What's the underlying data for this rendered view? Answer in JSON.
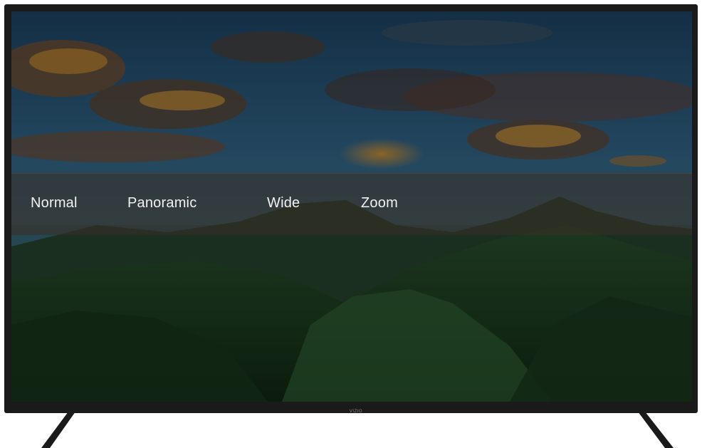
{
  "menu": {
    "items": [
      {
        "label": "Normal"
      },
      {
        "label": "Panoramic"
      },
      {
        "label": "Wide"
      },
      {
        "label": "Zoom"
      }
    ]
  },
  "tv": {
    "brand": "VIZIO"
  },
  "colors": {
    "bezel": "#1a1a1a",
    "menu_text": "#f2f2f2",
    "menu_overlay": "#3a2d24"
  }
}
